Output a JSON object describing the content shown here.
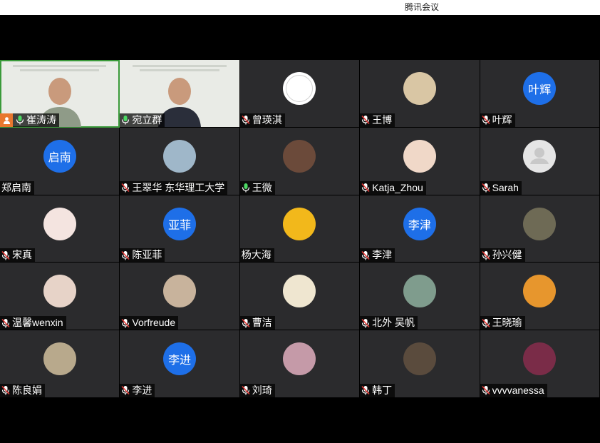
{
  "window": {
    "title": "腾讯会议"
  },
  "colors": {
    "accent": "#1e6fe8",
    "tile_bg": "#2b2b2d",
    "active_speaker": "#3a9a3a",
    "host_badge": "#e8772e"
  },
  "participants": [
    {
      "name": "崔涛涛",
      "kind": "video",
      "mic": "on",
      "host": true,
      "active": true
    },
    {
      "name": "宛立群",
      "kind": "video",
      "mic": "on"
    },
    {
      "name": "曾瑛淇",
      "kind": "ring",
      "mic": "muted"
    },
    {
      "name": "王博",
      "kind": "photo",
      "mic": "muted",
      "color": "#d9c6a4"
    },
    {
      "name": "叶辉",
      "kind": "text",
      "avatar_text": "叶辉",
      "mic": "muted"
    },
    {
      "name": "郑启南",
      "kind": "text",
      "avatar_text": "启南",
      "mic": "none"
    },
    {
      "name": "王翠华  东华理工大学",
      "kind": "photo",
      "mic": "muted",
      "color": "#9fb7c9"
    },
    {
      "name": "王微",
      "kind": "photo",
      "mic": "on",
      "color": "#6b4a3a"
    },
    {
      "name": "Katja_Zhou",
      "kind": "photo",
      "mic": "muted",
      "color": "#f0d8c8"
    },
    {
      "name": "Sarah",
      "kind": "gray",
      "mic": "muted"
    },
    {
      "name": "宋真",
      "kind": "photo",
      "mic": "muted",
      "color": "#f4e4e0"
    },
    {
      "name": "陈亚菲",
      "kind": "text",
      "avatar_text": "亚菲",
      "mic": "muted"
    },
    {
      "name": "杨大海",
      "kind": "photo",
      "mic": "none",
      "color": "#f2b81b"
    },
    {
      "name": "李津",
      "kind": "text",
      "avatar_text": "李津",
      "mic": "muted"
    },
    {
      "name": "孙兴健",
      "kind": "photo",
      "mic": "muted",
      "color": "#6e6a55"
    },
    {
      "name": "温馨wenxin",
      "kind": "photo",
      "mic": "muted",
      "color": "#e7d3c8"
    },
    {
      "name": "Vorfreude",
      "kind": "photo",
      "mic": "muted",
      "color": "#c8b39c"
    },
    {
      "name": "曹洁",
      "kind": "photo",
      "mic": "muted",
      "color": "#efe6d0"
    },
    {
      "name": "北外 吴帆",
      "kind": "photo",
      "mic": "muted",
      "color": "#7f9c8d"
    },
    {
      "name": "王晓瑜",
      "kind": "photo",
      "mic": "muted",
      "color": "#e7962d"
    },
    {
      "name": "陈良娟",
      "kind": "photo",
      "mic": "muted",
      "color": "#b8a98c"
    },
    {
      "name": "李进",
      "kind": "text",
      "avatar_text": "李进",
      "mic": "muted"
    },
    {
      "name": "刘琦",
      "kind": "photo",
      "mic": "muted",
      "color": "#c59aa8"
    },
    {
      "name": "韩丁",
      "kind": "photo",
      "mic": "muted",
      "color": "#5a4b3d"
    },
    {
      "name": "vvvvanessa",
      "kind": "photo",
      "mic": "muted",
      "color": "#7a2c48"
    }
  ]
}
